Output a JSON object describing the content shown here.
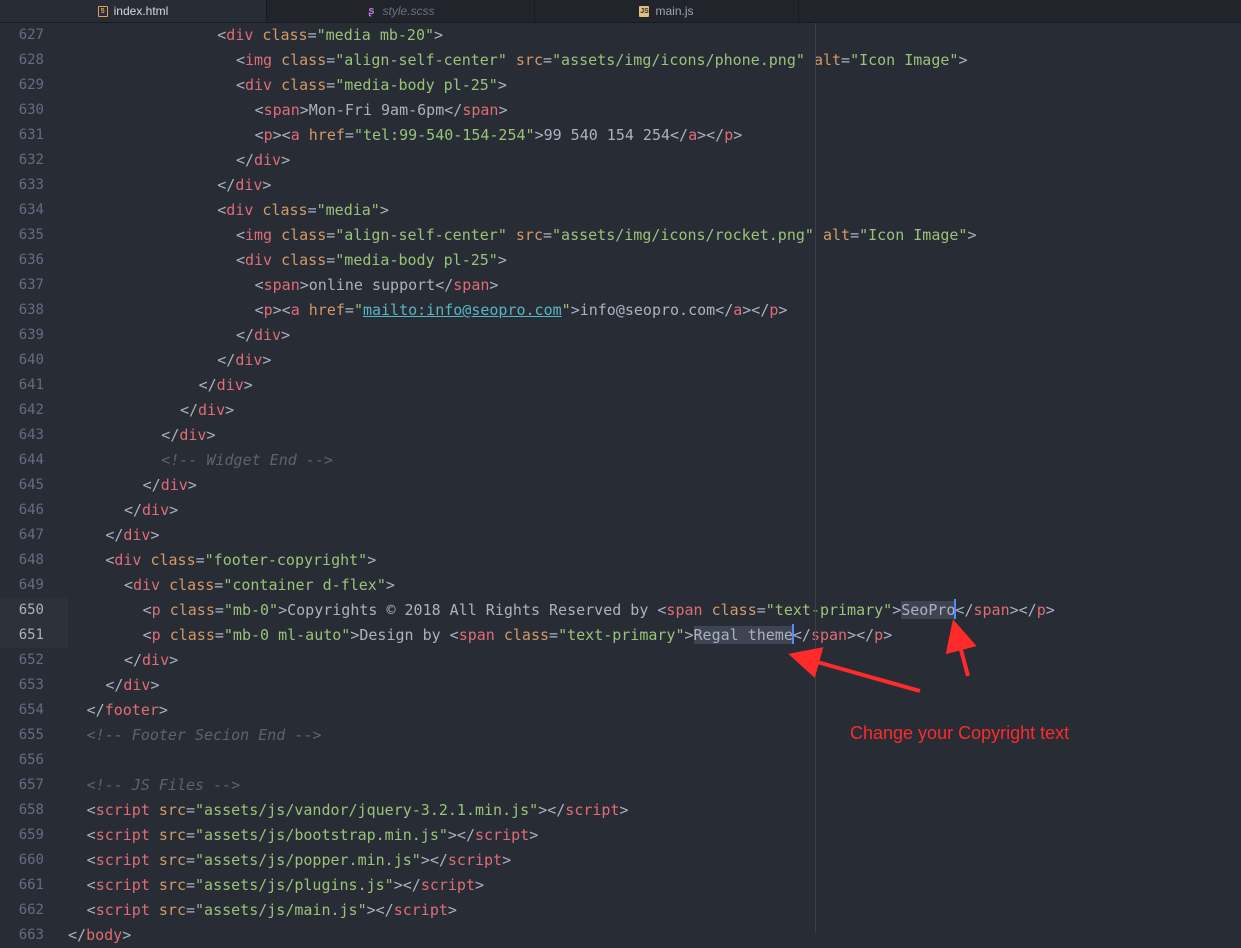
{
  "tabs": [
    {
      "label": "index.html",
      "icon": "html5-icon",
      "active": true
    },
    {
      "label": "style.scss",
      "icon": "sass-icon",
      "active": false
    },
    {
      "label": "main.js",
      "icon": "js-icon",
      "active": false
    }
  ],
  "annotation": {
    "text": "Change your Copyright text",
    "color": "#ff2a2a"
  },
  "colors": {
    "background": "#282c34",
    "tag": "#e06c75",
    "attribute": "#d19a66",
    "string": "#98c379",
    "comment": "#5c6370",
    "text": "#abb2bf"
  },
  "lines": [
    {
      "n": "627",
      "indent": 16,
      "tokens": [
        [
          "p",
          "<"
        ],
        [
          "t",
          "div"
        ],
        [
          "p",
          " "
        ],
        [
          "a",
          "class"
        ],
        [
          "p",
          "="
        ],
        [
          "s",
          "\"media mb-20\""
        ],
        [
          "p",
          ">"
        ]
      ]
    },
    {
      "n": "628",
      "indent": 18,
      "tokens": [
        [
          "p",
          "<"
        ],
        [
          "t",
          "img"
        ],
        [
          "p",
          " "
        ],
        [
          "a",
          "class"
        ],
        [
          "p",
          "="
        ],
        [
          "s",
          "\"align-self-center\""
        ],
        [
          "p",
          " "
        ],
        [
          "a",
          "src"
        ],
        [
          "p",
          "="
        ],
        [
          "s",
          "\"assets/img/icons/phone.png\""
        ],
        [
          "p",
          " "
        ],
        [
          "a",
          "alt"
        ],
        [
          "p",
          "="
        ],
        [
          "s",
          "\"Icon Image\""
        ],
        [
          "p",
          ">"
        ]
      ]
    },
    {
      "n": "629",
      "indent": 18,
      "tokens": [
        [
          "p",
          "<"
        ],
        [
          "t",
          "div"
        ],
        [
          "p",
          " "
        ],
        [
          "a",
          "class"
        ],
        [
          "p",
          "="
        ],
        [
          "s",
          "\"media-body pl-25\""
        ],
        [
          "p",
          ">"
        ]
      ]
    },
    {
      "n": "630",
      "indent": 20,
      "tokens": [
        [
          "p",
          "<"
        ],
        [
          "t",
          "span"
        ],
        [
          "p",
          ">Mon-Fri 9am-6pm</"
        ],
        [
          "t",
          "span"
        ],
        [
          "p",
          ">"
        ]
      ]
    },
    {
      "n": "631",
      "indent": 20,
      "tokens": [
        [
          "p",
          "<"
        ],
        [
          "t",
          "p"
        ],
        [
          "p",
          "><"
        ],
        [
          "t",
          "a"
        ],
        [
          "p",
          " "
        ],
        [
          "a",
          "href"
        ],
        [
          "p",
          "="
        ],
        [
          "s",
          "\"tel:99-540-154-254\""
        ],
        [
          "p",
          ">99 540 154 254</"
        ],
        [
          "t",
          "a"
        ],
        [
          "p",
          "></"
        ],
        [
          "t",
          "p"
        ],
        [
          "p",
          ">"
        ]
      ]
    },
    {
      "n": "632",
      "indent": 18,
      "tokens": [
        [
          "p",
          "</"
        ],
        [
          "t",
          "div"
        ],
        [
          "p",
          ">"
        ]
      ]
    },
    {
      "n": "633",
      "indent": 16,
      "tokens": [
        [
          "p",
          "</"
        ],
        [
          "t",
          "div"
        ],
        [
          "p",
          ">"
        ]
      ]
    },
    {
      "n": "634",
      "indent": 16,
      "tokens": [
        [
          "p",
          "<"
        ],
        [
          "t",
          "div"
        ],
        [
          "p",
          " "
        ],
        [
          "a",
          "class"
        ],
        [
          "p",
          "="
        ],
        [
          "s",
          "\"media\""
        ],
        [
          "p",
          ">"
        ]
      ]
    },
    {
      "n": "635",
      "indent": 18,
      "tokens": [
        [
          "p",
          "<"
        ],
        [
          "t",
          "img"
        ],
        [
          "p",
          " "
        ],
        [
          "a",
          "class"
        ],
        [
          "p",
          "="
        ],
        [
          "s",
          "\"align-self-center\""
        ],
        [
          "p",
          " "
        ],
        [
          "a",
          "src"
        ],
        [
          "p",
          "="
        ],
        [
          "s",
          "\"assets/img/icons/rocket.png\""
        ],
        [
          "p",
          " "
        ],
        [
          "a",
          "alt"
        ],
        [
          "p",
          "="
        ],
        [
          "s",
          "\"Icon Image\""
        ],
        [
          "p",
          ">"
        ]
      ]
    },
    {
      "n": "636",
      "indent": 18,
      "tokens": [
        [
          "p",
          "<"
        ],
        [
          "t",
          "div"
        ],
        [
          "p",
          " "
        ],
        [
          "a",
          "class"
        ],
        [
          "p",
          "="
        ],
        [
          "s",
          "\"media-body pl-25\""
        ],
        [
          "p",
          ">"
        ]
      ]
    },
    {
      "n": "637",
      "indent": 20,
      "tokens": [
        [
          "p",
          "<"
        ],
        [
          "t",
          "span"
        ],
        [
          "p",
          ">online support</"
        ],
        [
          "t",
          "span"
        ],
        [
          "p",
          ">"
        ]
      ]
    },
    {
      "n": "638",
      "indent": 20,
      "tokens": [
        [
          "p",
          "<"
        ],
        [
          "t",
          "p"
        ],
        [
          "p",
          "><"
        ],
        [
          "t",
          "a"
        ],
        [
          "p",
          " "
        ],
        [
          "a",
          "href"
        ],
        [
          "p",
          "="
        ],
        [
          "s",
          "\""
        ],
        [
          "u",
          "mailto:info@seopro.com"
        ],
        [
          "s",
          "\""
        ],
        [
          "p",
          ">info@seopro.com</"
        ],
        [
          "t",
          "a"
        ],
        [
          "p",
          "></"
        ],
        [
          "t",
          "p"
        ],
        [
          "p",
          ">"
        ]
      ]
    },
    {
      "n": "639",
      "indent": 18,
      "tokens": [
        [
          "p",
          "</"
        ],
        [
          "t",
          "div"
        ],
        [
          "p",
          ">"
        ]
      ]
    },
    {
      "n": "640",
      "indent": 16,
      "tokens": [
        [
          "p",
          "</"
        ],
        [
          "t",
          "div"
        ],
        [
          "p",
          ">"
        ]
      ]
    },
    {
      "n": "641",
      "indent": 14,
      "tokens": [
        [
          "p",
          "</"
        ],
        [
          "t",
          "div"
        ],
        [
          "p",
          ">"
        ]
      ]
    },
    {
      "n": "642",
      "indent": 12,
      "tokens": [
        [
          "p",
          "</"
        ],
        [
          "t",
          "div"
        ],
        [
          "p",
          ">"
        ]
      ]
    },
    {
      "n": "643",
      "indent": 10,
      "tokens": [
        [
          "p",
          "</"
        ],
        [
          "t",
          "div"
        ],
        [
          "p",
          ">"
        ]
      ]
    },
    {
      "n": "644",
      "indent": 10,
      "tokens": [
        [
          "c",
          "<!-- Widget End -->"
        ]
      ]
    },
    {
      "n": "645",
      "indent": 8,
      "tokens": [
        [
          "p",
          "</"
        ],
        [
          "t",
          "div"
        ],
        [
          "p",
          ">"
        ]
      ]
    },
    {
      "n": "646",
      "indent": 6,
      "tokens": [
        [
          "p",
          "</"
        ],
        [
          "t",
          "div"
        ],
        [
          "p",
          ">"
        ]
      ]
    },
    {
      "n": "647",
      "indent": 4,
      "tokens": [
        [
          "p",
          "</"
        ],
        [
          "t",
          "div"
        ],
        [
          "p",
          ">"
        ]
      ]
    },
    {
      "n": "648",
      "indent": 4,
      "tokens": [
        [
          "p",
          "<"
        ],
        [
          "t",
          "div"
        ],
        [
          "p",
          " "
        ],
        [
          "a",
          "class"
        ],
        [
          "p",
          "="
        ],
        [
          "s",
          "\"footer-copyright\""
        ],
        [
          "p",
          ">"
        ]
      ]
    },
    {
      "n": "649",
      "indent": 6,
      "tokens": [
        [
          "p",
          "<"
        ],
        [
          "t",
          "div"
        ],
        [
          "p",
          " "
        ],
        [
          "a",
          "class"
        ],
        [
          "p",
          "="
        ],
        [
          "s",
          "\"container d-flex\""
        ],
        [
          "p",
          ">"
        ]
      ]
    },
    {
      "n": "650",
      "indent": 8,
      "current": true,
      "tokens": [
        [
          "p",
          "<"
        ],
        [
          "t",
          "p"
        ],
        [
          "p",
          " "
        ],
        [
          "a",
          "class"
        ],
        [
          "p",
          "="
        ],
        [
          "s",
          "\"mb-0\""
        ],
        [
          "p",
          ">Copyrights © 2018 All Rights Reserved by <"
        ],
        [
          "t",
          "span"
        ],
        [
          "p",
          " "
        ],
        [
          "a",
          "class"
        ],
        [
          "p",
          "="
        ],
        [
          "s",
          "\"text-primary\""
        ],
        [
          "p",
          ">"
        ],
        [
          "sel",
          "SeoPro"
        ],
        [
          "caret",
          ""
        ],
        [
          "p",
          "</"
        ],
        [
          "t",
          "span"
        ],
        [
          "p",
          "></"
        ],
        [
          "t",
          "p"
        ],
        [
          "p",
          ">"
        ]
      ]
    },
    {
      "n": "651",
      "indent": 8,
      "current": true,
      "tokens": [
        [
          "p",
          "<"
        ],
        [
          "t",
          "p"
        ],
        [
          "p",
          " "
        ],
        [
          "a",
          "class"
        ],
        [
          "p",
          "="
        ],
        [
          "s",
          "\"mb-0 ml-auto\""
        ],
        [
          "p",
          ">Design by <"
        ],
        [
          "t",
          "span"
        ],
        [
          "p",
          " "
        ],
        [
          "a",
          "class"
        ],
        [
          "p",
          "="
        ],
        [
          "s",
          "\"text-primary\""
        ],
        [
          "p",
          ">"
        ],
        [
          "sel",
          "Regal theme"
        ],
        [
          "caret",
          ""
        ],
        [
          "p",
          "</"
        ],
        [
          "t",
          "span"
        ],
        [
          "p",
          "></"
        ],
        [
          "t",
          "p"
        ],
        [
          "p",
          ">"
        ]
      ]
    },
    {
      "n": "652",
      "indent": 6,
      "tokens": [
        [
          "p",
          "</"
        ],
        [
          "t",
          "div"
        ],
        [
          "p",
          ">"
        ]
      ]
    },
    {
      "n": "653",
      "indent": 4,
      "tokens": [
        [
          "p",
          "</"
        ],
        [
          "t",
          "div"
        ],
        [
          "p",
          ">"
        ]
      ]
    },
    {
      "n": "654",
      "indent": 2,
      "tokens": [
        [
          "p",
          "</"
        ],
        [
          "t",
          "footer"
        ],
        [
          "p",
          ">"
        ]
      ]
    },
    {
      "n": "655",
      "indent": 2,
      "tokens": [
        [
          "c",
          "<!-- Footer Secion End -->"
        ]
      ]
    },
    {
      "n": "656",
      "indent": 0,
      "tokens": []
    },
    {
      "n": "657",
      "indent": 2,
      "tokens": [
        [
          "c",
          "<!-- JS Files -->"
        ]
      ]
    },
    {
      "n": "658",
      "indent": 2,
      "tokens": [
        [
          "p",
          "<"
        ],
        [
          "t",
          "script"
        ],
        [
          "p",
          " "
        ],
        [
          "a",
          "src"
        ],
        [
          "p",
          "="
        ],
        [
          "s",
          "\"assets/js/vandor/jquery-3.2.1.min.js\""
        ],
        [
          "p",
          "></"
        ],
        [
          "t",
          "script"
        ],
        [
          "p",
          ">"
        ]
      ]
    },
    {
      "n": "659",
      "indent": 2,
      "tokens": [
        [
          "p",
          "<"
        ],
        [
          "t",
          "script"
        ],
        [
          "p",
          " "
        ],
        [
          "a",
          "src"
        ],
        [
          "p",
          "="
        ],
        [
          "s",
          "\"assets/js/bootstrap.min.js\""
        ],
        [
          "p",
          "></"
        ],
        [
          "t",
          "script"
        ],
        [
          "p",
          ">"
        ]
      ]
    },
    {
      "n": "660",
      "indent": 2,
      "tokens": [
        [
          "p",
          "<"
        ],
        [
          "t",
          "script"
        ],
        [
          "p",
          " "
        ],
        [
          "a",
          "src"
        ],
        [
          "p",
          "="
        ],
        [
          "s",
          "\"assets/js/popper.min.js\""
        ],
        [
          "p",
          "></"
        ],
        [
          "t",
          "script"
        ],
        [
          "p",
          ">"
        ]
      ]
    },
    {
      "n": "661",
      "indent": 2,
      "tokens": [
        [
          "p",
          "<"
        ],
        [
          "t",
          "script"
        ],
        [
          "p",
          " "
        ],
        [
          "a",
          "src"
        ],
        [
          "p",
          "="
        ],
        [
          "s",
          "\"assets/js/plugins.js\""
        ],
        [
          "p",
          "></"
        ],
        [
          "t",
          "script"
        ],
        [
          "p",
          ">"
        ]
      ]
    },
    {
      "n": "662",
      "indent": 2,
      "tokens": [
        [
          "p",
          "<"
        ],
        [
          "t",
          "script"
        ],
        [
          "p",
          " "
        ],
        [
          "a",
          "src"
        ],
        [
          "p",
          "="
        ],
        [
          "s",
          "\"assets/js/main.js\""
        ],
        [
          "p",
          "></"
        ],
        [
          "t",
          "script"
        ],
        [
          "p",
          ">"
        ]
      ]
    },
    {
      "n": "663",
      "indent": 0,
      "tokens": [
        [
          "p",
          "</"
        ],
        [
          "t",
          "body"
        ],
        [
          "p",
          ">"
        ]
      ]
    }
  ]
}
